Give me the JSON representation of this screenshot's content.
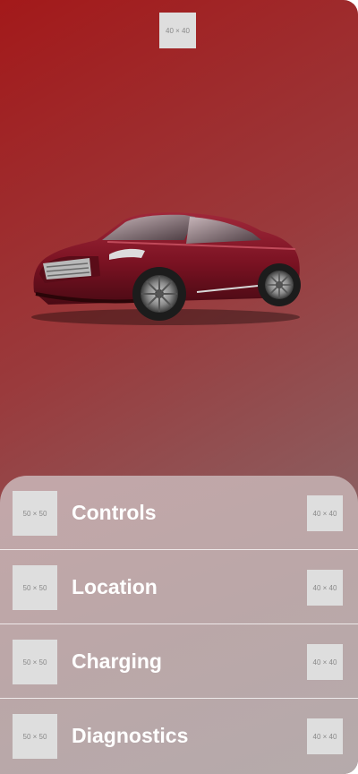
{
  "header": {
    "logo_placeholder": "40 × 40"
  },
  "car_image": {
    "alt": "car",
    "colors": {
      "body": "#7a1222",
      "body_highlight": "#a0283a",
      "window": "#4a3a40",
      "tire": "#1c1c1c",
      "rim": "#8c8c8c"
    }
  },
  "menu": {
    "items": [
      {
        "label": "Controls",
        "icon_placeholder": "50 × 50",
        "arrow_placeholder": "40 × 40"
      },
      {
        "label": "Location",
        "icon_placeholder": "50 × 50",
        "arrow_placeholder": "40 × 40"
      },
      {
        "label": "Charging",
        "icon_placeholder": "50 × 50",
        "arrow_placeholder": "40 × 40"
      },
      {
        "label": "Diagnostics",
        "icon_placeholder": "50 × 50",
        "arrow_placeholder": "40 × 40"
      }
    ]
  },
  "colors": {
    "background_start": "#a3191a",
    "background_end": "#7d6a6c",
    "panel": "#c3a7a9",
    "text": "#ffffff",
    "placeholder": "#dedede"
  }
}
